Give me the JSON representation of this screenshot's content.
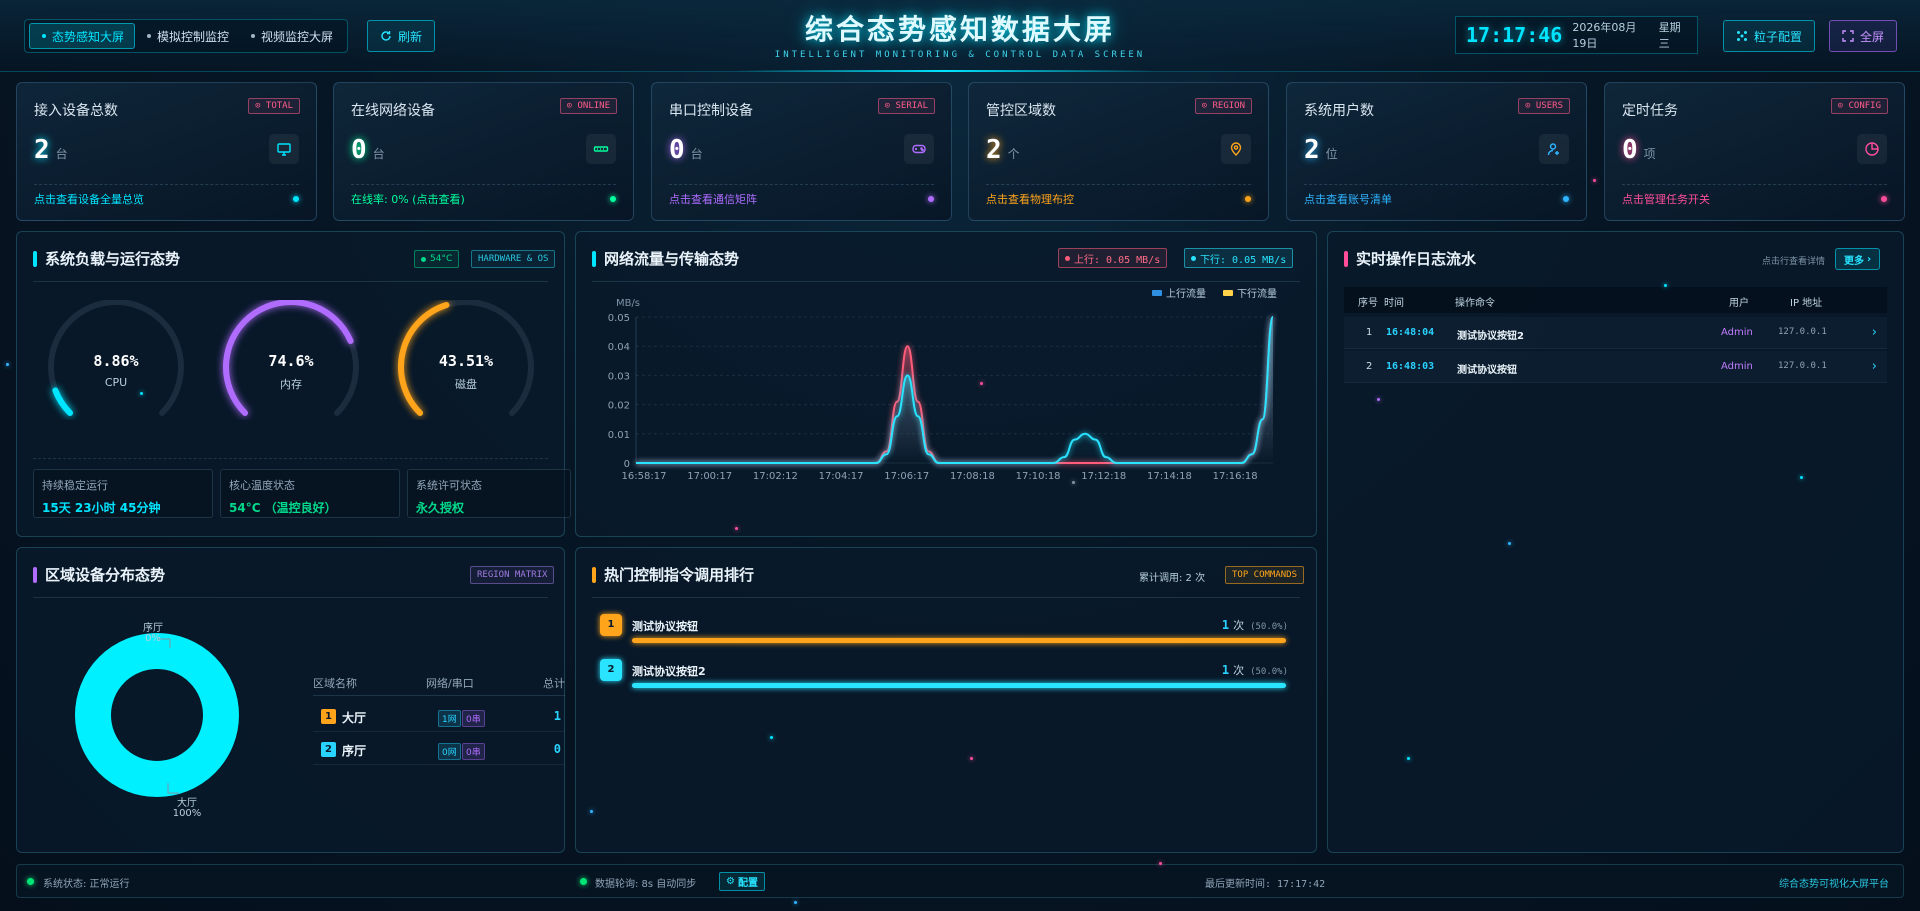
{
  "header": {
    "nav": [
      {
        "label": "态势感知大屏",
        "active": true
      },
      {
        "label": "模拟控制监控",
        "active": false
      },
      {
        "label": "视频监控大屏",
        "active": false
      }
    ],
    "refresh_label": "刷新",
    "title": "综合态势感知数据大屏",
    "subtitle": "INTELLIGENT MONITORING & CONTROL DATA SCREEN",
    "time": "17:17:46",
    "date": "2026年08月19日",
    "weekday": "星期三",
    "particle_label": "粒子配置",
    "fullscreen_label": "全屏"
  },
  "cards": [
    {
      "title": "接入设备总数",
      "tag": "TOTAL",
      "value": "2",
      "unit": "台",
      "link": "点击查看设备全量总览",
      "color": "#00e5ff",
      "tag_color": "#ff5c8a",
      "icon": "monitor-icon"
    },
    {
      "title": "在线网络设备",
      "tag": "ONLINE",
      "value": "0",
      "unit": "台",
      "link": "在线率: 0% (点击查看)",
      "color": "#00ff9d",
      "tag_color": "#ff5c8a",
      "icon": "network-icon"
    },
    {
      "title": "串口控制设备",
      "tag": "SERIAL",
      "value": "0",
      "unit": "台",
      "link": "点击查看通信矩阵",
      "color": "#b06cff",
      "tag_color": "#ff5c8a",
      "icon": "gamepad-icon"
    },
    {
      "title": "管控区域数",
      "tag": "REGION",
      "value": "2",
      "unit": "个",
      "link": "点击查看物理布控",
      "color": "#ffa41b",
      "tag_color": "#ff5c8a",
      "icon": "location-icon"
    },
    {
      "title": "系统用户数",
      "tag": "USERS",
      "value": "2",
      "unit": "位",
      "link": "点击查看账号清单",
      "color": "#2fb4ff",
      "tag_color": "#ff5c8a",
      "icon": "user-icon"
    },
    {
      "title": "定时任务",
      "tag": "CONFIG",
      "value": "0",
      "unit": "项",
      "link": "点击管理任务开关",
      "color": "#ff4d9a",
      "tag_color": "#ff5c8a",
      "icon": "pie-icon"
    }
  ],
  "system": {
    "title": "系统负载与运行态势",
    "temp_tag": "54°C",
    "hw_tag": "HARDWARE & OS",
    "gauges": [
      {
        "label": "CPU",
        "value": "8.86%",
        "fraction": 0.0886,
        "color": "#00e5ff"
      },
      {
        "label": "内存",
        "value": "74.6%",
        "fraction": 0.746,
        "color": "#b06cff"
      },
      {
        "label": "磁盘",
        "value": "43.51%",
        "fraction": 0.4351,
        "color": "#ffa41b"
      }
    ],
    "info": [
      {
        "label": "持续稳定运行",
        "value": "15天 23小时 45分钟",
        "color": "#00e5ff"
      },
      {
        "label": "核心温度状态",
        "value": "54°C （温控良好）",
        "color": "#00d98b"
      },
      {
        "label": "系统许可状态",
        "value": "永久授权",
        "color": "#00d98b"
      }
    ]
  },
  "network": {
    "title": "网络流量与传输态势",
    "up_tag": "上行: 0.05 MB/s",
    "down_tag": "下行: 0.05 MB/s"
  },
  "chart_data": {
    "type": "area",
    "ylabel": "MB/s",
    "ylim": [
      0,
      0.05
    ],
    "yticks": [
      "0",
      "0.01",
      "0.02",
      "0.03",
      "0.04",
      "0.05"
    ],
    "x_labels": [
      "16:58:17",
      "17:00:17",
      "17:02:12",
      "17:04:17",
      "17:06:17",
      "17:08:18",
      "17:10:18",
      "17:12:18",
      "17:14:18",
      "17:16:18"
    ],
    "legend": [
      "上行流量",
      "下行流量"
    ],
    "legend_position": "top-right",
    "grid": true,
    "series": [
      {
        "name": "上行流量",
        "color": "#ff5c7a",
        "values": [
          0,
          0,
          0,
          0,
          0,
          0,
          0,
          0,
          0,
          0,
          0,
          0,
          0,
          0,
          0,
          0,
          0,
          0,
          0,
          0,
          0,
          0,
          0,
          0,
          0.004,
          0.021,
          0.04,
          0.021,
          0.004,
          0,
          0,
          0,
          0,
          0,
          0,
          0,
          0,
          0,
          0,
          0,
          0,
          0,
          0,
          0,
          0,
          0,
          0,
          0,
          0,
          0,
          0,
          0,
          0,
          0,
          0,
          0,
          0,
          0,
          0,
          0.003,
          0.015,
          0.05
        ]
      },
      {
        "name": "下行流量",
        "color": "#29e3ff",
        "values": [
          0,
          0,
          0,
          0,
          0,
          0,
          0,
          0,
          0,
          0,
          0,
          0,
          0,
          0,
          0,
          0,
          0,
          0,
          0,
          0,
          0,
          0,
          0,
          0,
          0.003,
          0.016,
          0.03,
          0.016,
          0.003,
          0,
          0,
          0,
          0,
          0,
          0,
          0,
          0,
          0,
          0,
          0,
          0,
          0.002,
          0.008,
          0.01,
          0.008,
          0.002,
          0,
          0,
          0,
          0,
          0,
          0,
          0,
          0,
          0,
          0,
          0,
          0,
          0,
          0.003,
          0.015,
          0.05
        ]
      }
    ]
  },
  "log": {
    "title": "实时操作日志流水",
    "hint": "点击行查看详情",
    "more_label": "更多",
    "columns": [
      "序号",
      "时间",
      "操作命令",
      "用户",
      "IP 地址"
    ],
    "rows": [
      {
        "index": "1",
        "time": "16:48:04",
        "command": "测试协议按钮2",
        "user": "Admin",
        "ip": "127.0.0.1",
        "arrow": "›"
      },
      {
        "index": "2",
        "time": "16:48:03",
        "command": "测试协议按钮",
        "user": "Admin",
        "ip": "127.0.0.1",
        "arrow": "›"
      }
    ]
  },
  "region": {
    "title": "区域设备分布态势",
    "tag": "REGION MATRIX",
    "columns": [
      "区域名称",
      "网络/串口",
      "总计"
    ],
    "rows": [
      {
        "rank": "1",
        "name": "大厅",
        "net": "1网",
        "serial": "0串",
        "total": "1",
        "color": "#ffa41b"
      },
      {
        "rank": "2",
        "name": "序厅",
        "net": "0网",
        "serial": "0串",
        "total": "0",
        "color": "#29d3ff"
      }
    ],
    "donut": {
      "slices": [
        {
          "name": "大厅",
          "percent": "100%",
          "value": 1,
          "color": "#00f0ff"
        },
        {
          "name": "序厅",
          "percent": "0%",
          "value": 0,
          "color": "#ffa41b"
        }
      ]
    }
  },
  "commands": {
    "title": "热门控制指令调用排行",
    "total_label": "累计调用: 2 次",
    "tag": "TOP COMMANDS",
    "rows": [
      {
        "rank": "1",
        "name": "测试协议按钮",
        "count": "1",
        "unit": "次",
        "percent": "(50.0%)",
        "fraction": 0.5,
        "color": "#ffa41b"
      },
      {
        "rank": "2",
        "name": "测试协议按钮2",
        "count": "1",
        "unit": "次",
        "percent": "(50.0%)",
        "fraction": 0.5,
        "color": "#29e3ff"
      }
    ]
  },
  "footer": {
    "status": "系统状态: 正常运行",
    "poll": "数据轮询: 8s 自动同步",
    "config_label": "配置",
    "updated": "最后更新时间: 17:17:42",
    "platform": "综合态势可视化大屏平台"
  }
}
